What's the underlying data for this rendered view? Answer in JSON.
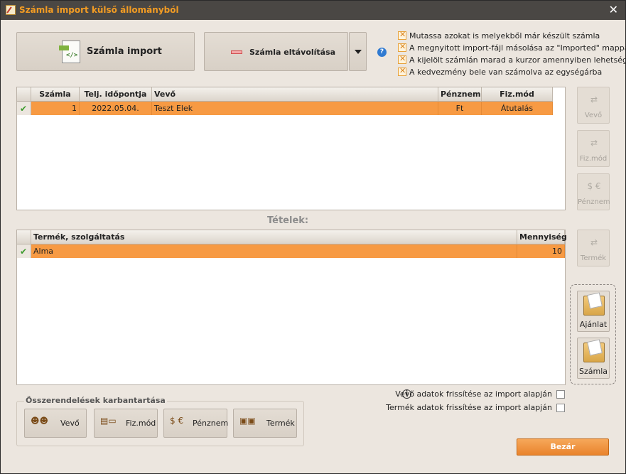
{
  "window": {
    "title": "Számla import külső állományból",
    "close_glyph": "✕"
  },
  "toolbar": {
    "import_label": "Számla import",
    "remove_label": "Számla eltávolítása",
    "help_glyph": "?"
  },
  "options": [
    {
      "label": "Mutassa azokat is melyekből már készült számla",
      "checked": true
    },
    {
      "label": "A megnyitott import-fájl másolása az \"Imported\" mappába",
      "checked": true
    },
    {
      "label": "A kijelölt számlán marad a kurzor amennyiben lehetséges",
      "checked": true
    },
    {
      "label": "A kedvezmény bele van számolva az egységárba",
      "checked": true
    }
  ],
  "invoices": {
    "columns": [
      "Számla",
      "Telj. időpontja",
      "Vevő",
      "Pénznem",
      "Fiz.mód"
    ],
    "rows": [
      {
        "szamla": "1",
        "datum": "2022.05.04.",
        "vevo": "Teszt Elek",
        "penznem": "Ft",
        "fizmod": "Átutalás"
      }
    ]
  },
  "items_title": "Tételek:",
  "items": {
    "columns": [
      "Termék, szolgáltatás",
      "Mennyiség"
    ],
    "rows": [
      {
        "termek": "Alma",
        "mennyiseg": "10"
      }
    ]
  },
  "side_buttons": {
    "vevo": "Vevő",
    "fizmod": "Fiz.mód",
    "penznem": "Pénznem",
    "termek": "Termék",
    "ajanlat": "Ajánlat",
    "szamla": "Számla"
  },
  "refresh": {
    "vevo_label": "Vevő adatok frissítése az import alapján",
    "termek_label": "Termék adatok frissítése az import alapján",
    "info_glyph": "i"
  },
  "mapping": {
    "legend": "Összerendelések karbantartása",
    "vevo": "Vevő",
    "fizmod": "Fiz.mód",
    "penznem": "Pénznem",
    "termek": "Termék"
  },
  "close_button": "Bezár",
  "check_glyph": "✔",
  "x_glyph": "✕"
}
